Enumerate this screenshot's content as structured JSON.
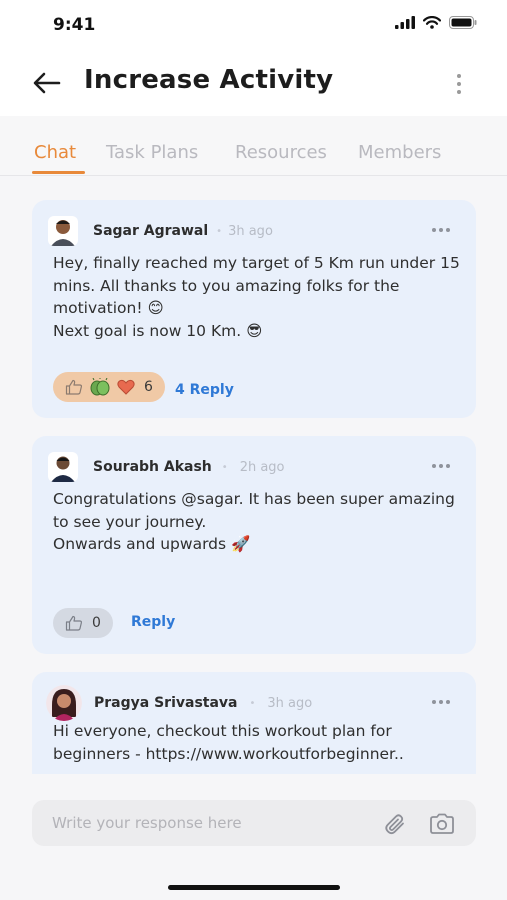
{
  "status_bar": {
    "time": "9:41"
  },
  "header": {
    "title": "Increase Activity"
  },
  "tabs": [
    {
      "label": "Chat",
      "active": true
    },
    {
      "label": "Task Plans",
      "active": false
    },
    {
      "label": "Resources",
      "active": false
    },
    {
      "label": "Members",
      "active": false
    }
  ],
  "messages": [
    {
      "author": "Sagar Agrawal",
      "time": "3h ago",
      "text": "Hey, finally reached my target of 5 Km run under 15 mins. All thanks to you amazing folks for the motivation! 😊\nNext goal is now 10 Km. 😎",
      "reactions": [
        "thumbs-up-icon",
        "clapping-hands-icon",
        "heart-icon"
      ],
      "reaction_count": "6",
      "reply_label": "4 Reply"
    },
    {
      "author": "Sourabh Akash",
      "time": "2h ago",
      "text": "Congratulations @sagar.  It has been super amazing to see your journey.\nOnwards and upwards 🚀",
      "reactions": [
        "thumbs-up-icon"
      ],
      "reaction_count": "0",
      "reply_label": "Reply"
    },
    {
      "author": "Pragya Srivastava",
      "time": "3h ago",
      "text": "Hi everyone, checkout this workout plan for beginners - https://www.workoutforbeginner.."
    }
  ],
  "composer": {
    "placeholder": "Write your response here"
  },
  "colors": {
    "accent": "#e8893a",
    "link": "#2f79d6",
    "card_bg": "#e9f0fb"
  }
}
